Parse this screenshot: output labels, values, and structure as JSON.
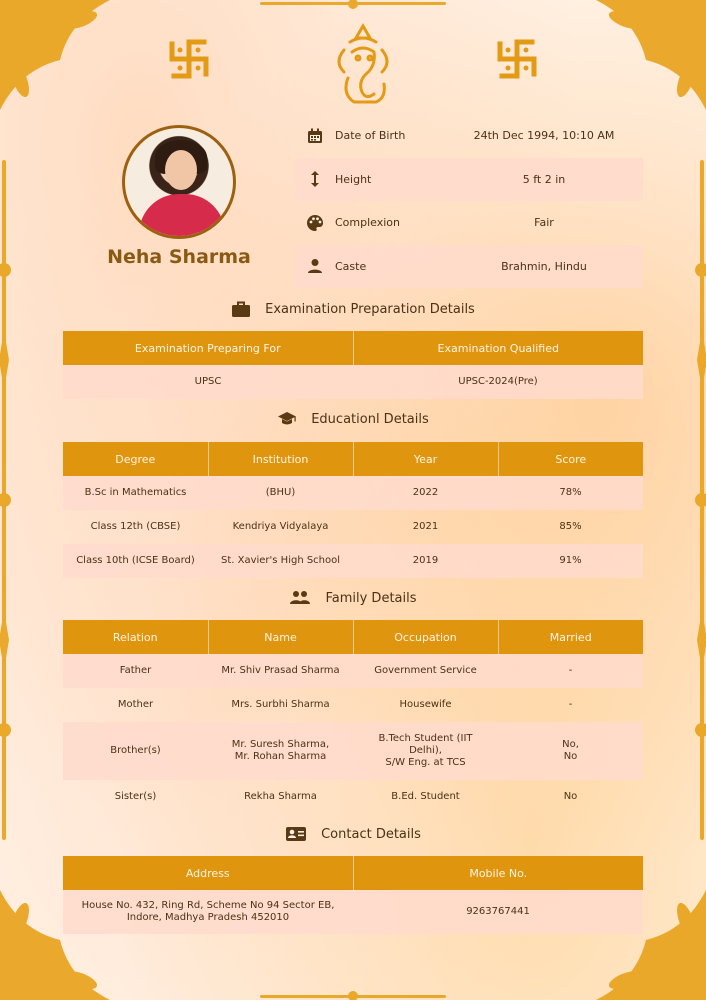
{
  "profile": {
    "name": "Neha Sharma",
    "details": [
      {
        "icon": "calendar-icon",
        "label": "Date of Birth",
        "value": "24th Dec 1994, 10:10 AM"
      },
      {
        "icon": "height-arrows-icon",
        "label": "Height",
        "value": "5 ft 2 in"
      },
      {
        "icon": "palette-icon",
        "label": "Complexion",
        "value": "Fair"
      },
      {
        "icon": "person-icon",
        "label": "Caste",
        "value": "Brahmin, Hindu"
      }
    ]
  },
  "exam": {
    "title": "Examination Preparation Details",
    "headers": [
      "Examination Preparing For",
      "Examination Qualified"
    ],
    "rows": [
      [
        "UPSC",
        "UPSC-2024(Pre)"
      ]
    ]
  },
  "education": {
    "title": "Educationl Details",
    "headers": [
      "Degree",
      "Institution",
      "Year",
      "Score"
    ],
    "rows": [
      [
        "B.Sc in Mathematics",
        "(BHU)",
        "2022",
        "78%"
      ],
      [
        "Class 12th (CBSE)",
        "Kendriya Vidyalaya",
        "2021",
        "85%"
      ],
      [
        "Class 10th (ICSE Board)",
        "St. Xavier's High School",
        "2019",
        "91%"
      ]
    ]
  },
  "family": {
    "title": "Family Details",
    "headers": [
      "Relation",
      "Name",
      "Occupation",
      "Married"
    ],
    "rows": [
      [
        "Father",
        "Mr. Shiv Prasad Sharma",
        "Government Service",
        "-"
      ],
      [
        "Mother",
        "Mrs. Surbhi Sharma",
        "Housewife",
        "-"
      ],
      [
        "Brother(s)",
        "Mr. Suresh Sharma,\nMr. Rohan Sharma",
        "B.Tech Student (IIT\nDelhi),\nS/W Eng. at TCS",
        "No,\nNo"
      ],
      [
        "Sister(s)",
        "Rekha Sharma",
        "B.Ed. Student",
        "No"
      ]
    ]
  },
  "contact": {
    "title": "Contact Details",
    "headers": [
      "Address",
      "Mobile No."
    ],
    "rows": [
      [
        "House No. 432, Ring Rd, Scheme No 94 Sector EB,\nIndore, Madhya Pradesh 452010",
        "9263767441"
      ]
    ]
  },
  "colors": {
    "gold": "#e0950e",
    "pink_row": "#ffdacd",
    "brown_text": "#8a5a14"
  }
}
